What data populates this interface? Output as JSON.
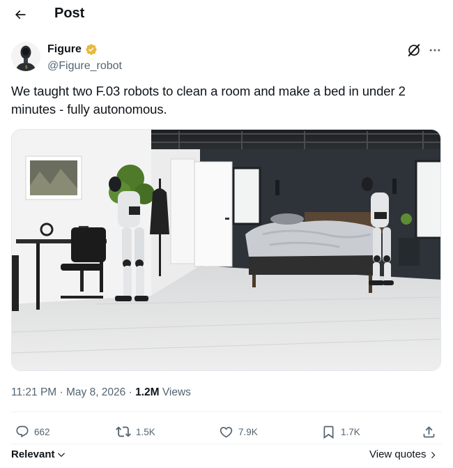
{
  "header": {
    "title": "Post",
    "back_icon": "arrow-left-icon"
  },
  "author": {
    "display_name": "Figure",
    "handle": "@Figure_robot",
    "verified_color": "#e8b93c"
  },
  "post": {
    "text": "We taught two F.03 robots to clean a room and make a bed in under 2 minutes - fully autonomous."
  },
  "meta": {
    "time": "11:21 PM",
    "sep1": " · ",
    "date": "May 8, 2026",
    "sep2": " · ",
    "views_count": "1.2M",
    "views_label": " Views"
  },
  "actions": {
    "replies": "662",
    "reposts": "1.5K",
    "likes": "7.9K",
    "bookmarks": "1.7K"
  },
  "footer": {
    "sort_label": "Relevant",
    "view_quotes_label": "View quotes"
  },
  "colors": {
    "text": "#0f1419",
    "secondary": "#536471",
    "divider": "#eff3f4"
  }
}
